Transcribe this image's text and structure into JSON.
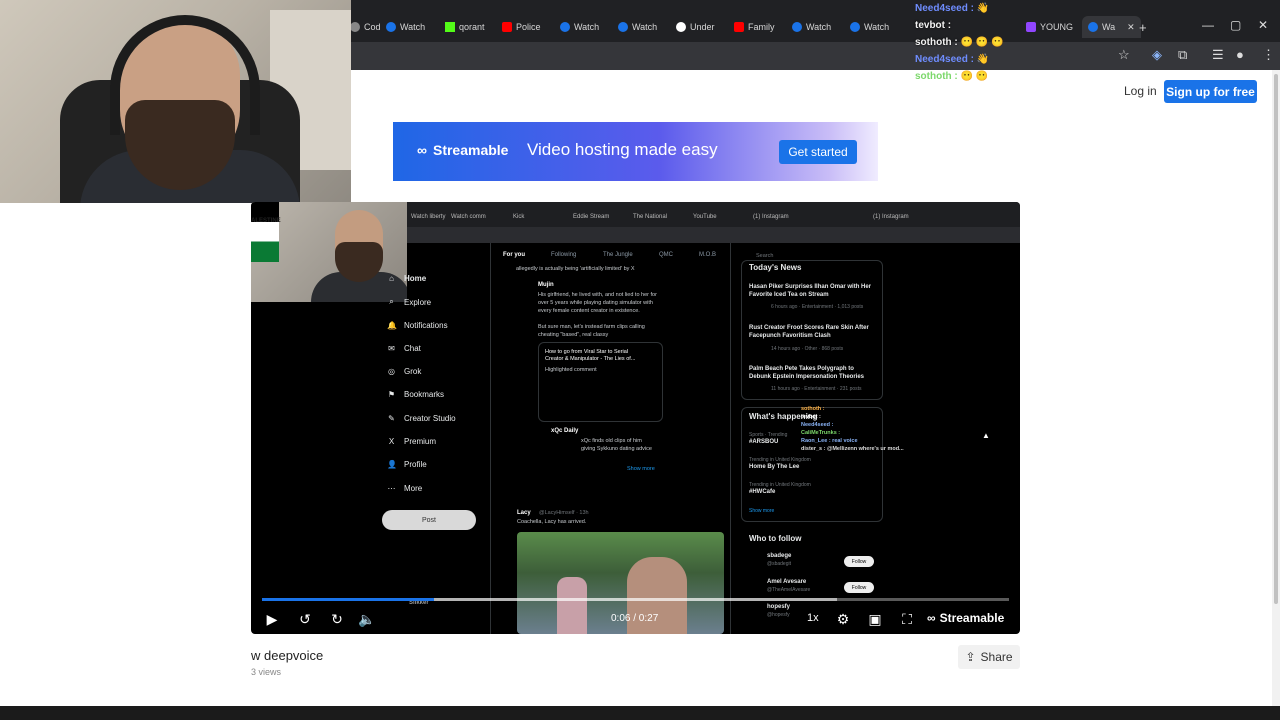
{
  "browser": {
    "tabs": [
      {
        "label": "Cod",
        "color": "#888888"
      },
      {
        "label": "Watch",
        "color": "#1a73e8"
      },
      {
        "label": "qorant",
        "color": "#53fc18"
      },
      {
        "label": "Police",
        "color": "#ff0000"
      },
      {
        "label": "Watch",
        "color": "#1a73e8"
      },
      {
        "label": "Watch",
        "color": "#1a73e8"
      },
      {
        "label": "Under",
        "color": "#ffffff"
      },
      {
        "label": "Family",
        "color": "#ff0000"
      },
      {
        "label": "Watch",
        "color": "#1a73e8"
      },
      {
        "label": "Watch",
        "color": "#1a73e8"
      },
      {
        "label": "YOUNG",
        "color": "#9146ff"
      },
      {
        "label": "Wa",
        "color": "#1a73e8"
      }
    ],
    "new_tab": "+",
    "minimize": "—",
    "maximize": "▢",
    "close": "✕"
  },
  "chat": [
    {
      "user": "Need4seed :",
      "msg": "👋",
      "style": "u1"
    },
    {
      "user": "tevbot :",
      "msg": "",
      "style": "u2"
    },
    {
      "user": "sothoth :",
      "msg": "😶 😶 😶",
      "style": "u2"
    },
    {
      "user": "Need4seed :",
      "msg": "👋",
      "style": "u1"
    },
    {
      "user": "sothoth :",
      "msg": "😶 😶",
      "style": "u3"
    }
  ],
  "site": {
    "login": "Log in",
    "signup": "Sign up for free"
  },
  "banner": {
    "logo": "Streamable",
    "tagline": "Video hosting made easy",
    "cta": "Get started"
  },
  "inner": {
    "tabs": [
      "Watch liberty",
      "Watch comm",
      "Kick",
      "Eddie Stream",
      "The National",
      "YouTube",
      "(1) Instagram",
      "(1) Instagram"
    ],
    "cam_flag": "ALESTINE",
    "nav": [
      "Home",
      "Explore",
      "Notifications",
      "Chat",
      "Grok",
      "Bookmarks",
      "Creator Studio",
      "Premium",
      "Profile",
      "More"
    ],
    "nav_icons": [
      "⌂",
      "⌕",
      "🔔",
      "✉",
      "◎",
      "⚑",
      "✎",
      "X",
      "👤",
      "⋯"
    ],
    "post": "Post",
    "feed_tabs": [
      "For you",
      "Following",
      "The Jungle",
      "QMC",
      "M.O.B"
    ],
    "tweet1_header": "allegedly is actually being 'artificially limited' by X",
    "tweet1_user": "Mujin",
    "tweet1_text1": "His girlfriend, he lived with, and not lied to her for",
    "tweet1_text2": "over 5 years while playing dating simulator with",
    "tweet1_text3": "every female content creator in existence.",
    "tweet1_text4": "But sure man, let's instead farm clips calling",
    "tweet1_text5": "cheating \"based\", real classy",
    "quote_title": "How to go from Viral Star to Serial",
    "quote_title2": "Creator & Manipulator - The Lies of...",
    "quote_sub": "Highlighted comment",
    "tweet2_user": "xQc Daily",
    "tweet2_text": "xQc finds old clips of him",
    "tweet2_text2": "giving Sykkuno dating advice",
    "show_more": "Show more",
    "tweet3_user": "Lacy",
    "tweet3_handle": "@LacyHimself · 13h",
    "tweet3_text": "Coachella, Lacy has arrived.",
    "news_title": "Today's News",
    "news": [
      {
        "title": "Hasan Piker Surprises Ilhan Omar with Her",
        "title2": "Favorite Iced Tea on Stream",
        "meta": "6 hours ago · Entertainment · 1,013 posts"
      },
      {
        "title": "Rust Creator Froot Scores Rare Skin After",
        "title2": "Facepunch Favoritism Clash",
        "meta": "14 hours ago · Other · 868 posts"
      },
      {
        "title": "Palm Beach Pete Takes Polygraph to",
        "title2": "Debunk Epstein Impersonation Theories",
        "meta": "11 hours ago · Entertainment · 231 posts"
      }
    ],
    "happening_title": "What's happening",
    "trends": [
      {
        "meta": "Sports · Trending",
        "name": "#ARSBOU"
      },
      {
        "meta": "Trending in United Kingdom",
        "name": "Home By The Lee"
      },
      {
        "meta": "Trending in United Kingdom",
        "name": "#HWCafe"
      }
    ],
    "trends_more": "Show more",
    "who_title": "Who to follow",
    "who": [
      {
        "name": "sbadege",
        "handle": "@sbadegit",
        "btn": "Follow"
      },
      {
        "name": "Amel Avesare",
        "handle": "@TheAmelAvesare",
        "btn": "Follow"
      },
      {
        "name": "hopesfy",
        "handle": "@hopesfy",
        "btn": "Follow"
      }
    ],
    "sidebar_user": "Slikker",
    "chat": [
      "sothoth :",
      "tevbot :",
      "Need4seed :",
      "CaliMeTrunks :",
      "Raon_Lee : real voice",
      "dister_s : @Mellizenn where's ur mod..."
    ],
    "search_placeholder": "Search"
  },
  "player": {
    "progress": 0.23,
    "buffered": 0.77,
    "time": "0:06 / 0:27",
    "speed": "1x",
    "brand": "Streamable"
  },
  "video": {
    "title": "w deepvoice",
    "views": "3 views",
    "share": "Share"
  }
}
